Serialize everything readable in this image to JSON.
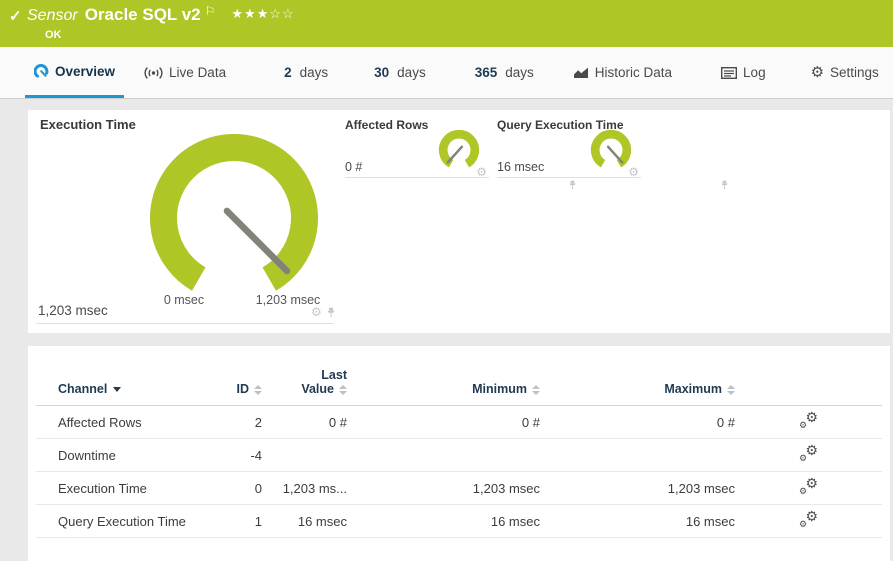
{
  "colors": {
    "brand_green": "#b0c526",
    "accent_blue": "#1e96d4",
    "needle_gray": "#82827a",
    "header_navy": "#1f3a52"
  },
  "titlebar": {
    "check_icon": "✓",
    "kind_label": "Sensor",
    "sensor_name": "Oracle SQL v2",
    "flag_icon": "⚐",
    "stars_filled": "★★★",
    "stars_empty": "☆☆",
    "status": "OK"
  },
  "tabs": {
    "overview": {
      "label": "Overview"
    },
    "live_data": {
      "label": "Live Data"
    },
    "days2": {
      "number": "2",
      "label": "days"
    },
    "days30": {
      "number": "30",
      "label": "days"
    },
    "days365": {
      "number": "365",
      "label": "days"
    },
    "historic": {
      "label": "Historic Data"
    },
    "log": {
      "label": "Log"
    },
    "settings": {
      "label": "Settings"
    },
    "settings_gear_icon": "⚙"
  },
  "gauges": {
    "main": {
      "title": "Execution Time",
      "value": "1,203 msec",
      "scale_min": "0 msec",
      "scale_max": "1,203 msec",
      "needle_deg": 135
    },
    "affected_rows": {
      "title": "Affected Rows",
      "value": "0 #",
      "needle_deg": 222
    },
    "query_exec": {
      "title": "Query Execution Time",
      "value": "16 msec",
      "needle_deg": 138
    },
    "tile_gear_icon": "⚙"
  },
  "table": {
    "headers": {
      "channel": "Channel",
      "id": "ID",
      "last_value_line1": "Last",
      "last_value_line2": "Value",
      "minimum": "Minimum",
      "maximum": "Maximum"
    },
    "gear_icon": "⚙",
    "rows": [
      {
        "channel": "Affected Rows",
        "id": "2",
        "last": "0 #",
        "min": "0 #",
        "max": "0 #"
      },
      {
        "channel": "Downtime",
        "id": "-4",
        "last": "",
        "min": "",
        "max": ""
      },
      {
        "channel": "Execution Time",
        "id": "0",
        "last": "1,203 ms...",
        "min": "1,203 msec",
        "max": "1,203 msec"
      },
      {
        "channel": "Query Execution Time",
        "id": "1",
        "last": "16 msec",
        "min": "16 msec",
        "max": "16 msec"
      }
    ]
  }
}
